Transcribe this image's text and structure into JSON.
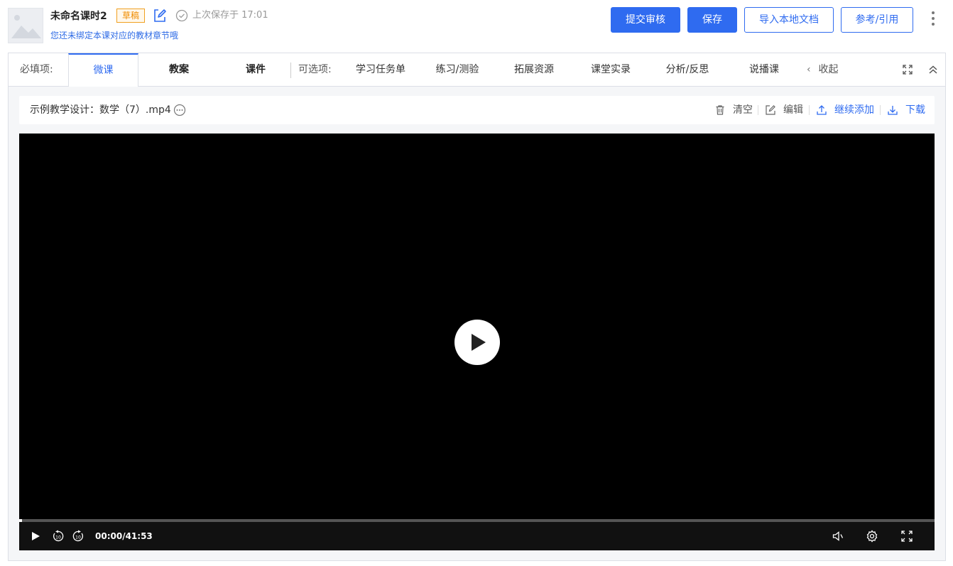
{
  "header": {
    "lesson_title": "未命名课时2",
    "status_badge": "草稿",
    "saved_text": "上次保存于 17:01",
    "bind_hint": "您还未绑定本课对应的教材章节哦",
    "buttons": {
      "submit": "提交审核",
      "save": "保存",
      "import": "导入本地文档",
      "reference": "参考/引用"
    }
  },
  "tabs": {
    "required_label": "必填项:",
    "optional_label": "可选项:",
    "required": [
      {
        "label": "微课",
        "active": true
      },
      {
        "label": "教案",
        "active": false
      },
      {
        "label": "课件",
        "active": false
      }
    ],
    "optional": [
      {
        "label": "学习任务单"
      },
      {
        "label": "练习/测验"
      },
      {
        "label": "拓展资源"
      },
      {
        "label": "课堂实录"
      },
      {
        "label": "分析/反思"
      },
      {
        "label": "说播课"
      }
    ],
    "collapse_label": "收起"
  },
  "file": {
    "name": "示例教学设计：数学（7）.mp4",
    "actions": {
      "clear": "清空",
      "edit": "编辑",
      "continue_add": "继续添加",
      "download": "下载"
    }
  },
  "player": {
    "time_display": "00:00/41:53",
    "progress": 0.003
  },
  "colors": {
    "accent": "#2f6bf0",
    "draft": "#f08c00",
    "annotation": "#f04848"
  }
}
